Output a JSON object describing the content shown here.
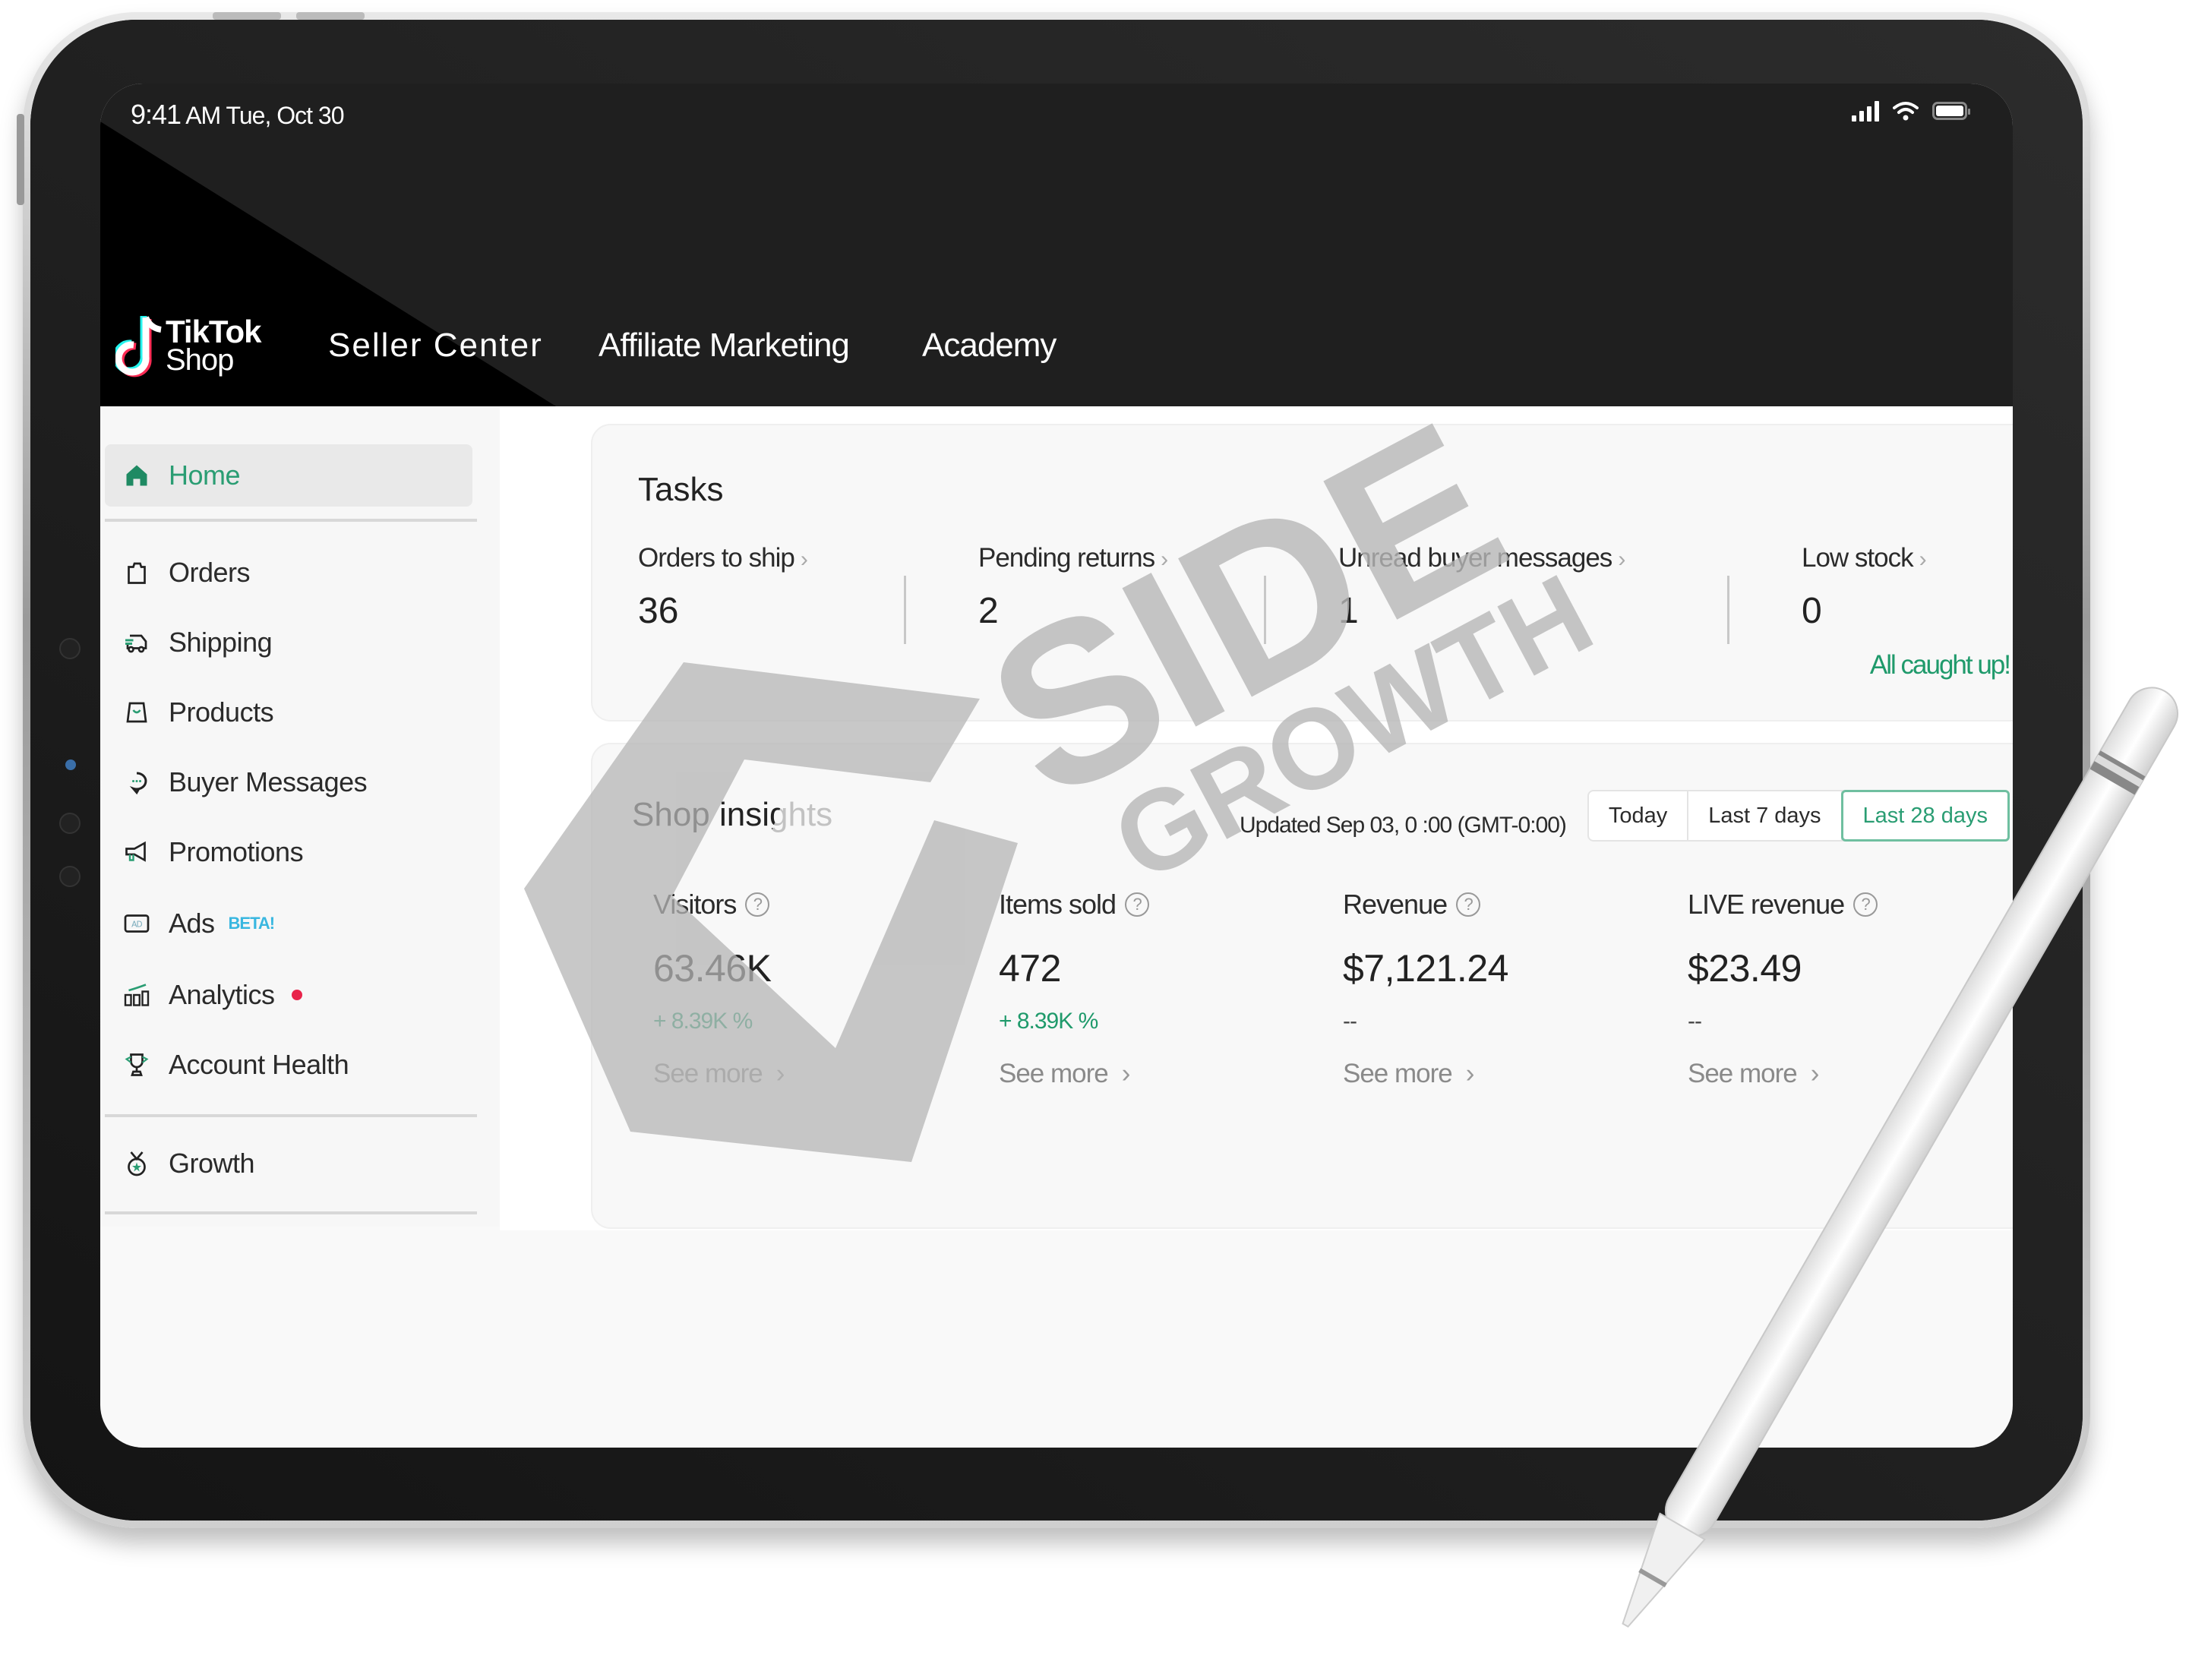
{
  "status_bar": {
    "time": "9:41",
    "date": "AM Tue, Oct 30",
    "icons": [
      "cellular-signal-icon",
      "wifi-icon",
      "battery-icon"
    ]
  },
  "header": {
    "logo": {
      "line1": "TikTok",
      "line2": "Shop",
      "icon": "tiktok-note-icon"
    },
    "nav": [
      {
        "label": "Seller Center"
      },
      {
        "label": "Affiliate Marketing"
      },
      {
        "label": "Academy"
      }
    ]
  },
  "sidebar": {
    "items": [
      {
        "label": "Home",
        "icon": "home-icon",
        "active": true
      },
      {
        "label": "Orders",
        "icon": "bag-icon"
      },
      {
        "label": "Shipping",
        "icon": "truck-icon"
      },
      {
        "label": "Products",
        "icon": "shopping-bag-icon"
      },
      {
        "label": "Buyer Messages",
        "icon": "chat-bubble-icon"
      },
      {
        "label": "Promotions",
        "icon": "megaphone-icon"
      },
      {
        "label": "Ads",
        "icon": "ad-icon",
        "badge": "BETA!"
      },
      {
        "label": "Analytics",
        "icon": "bar-chart-icon",
        "notification_dot": true
      },
      {
        "label": "Account Health",
        "icon": "trophy-icon"
      },
      {
        "label": "Growth",
        "icon": "medal-icon"
      }
    ]
  },
  "tasks": {
    "title": "Tasks",
    "items": [
      {
        "label": "Orders to ship",
        "value": "36"
      },
      {
        "label": "Pending returns",
        "value": "2"
      },
      {
        "label": "Unread buyer messages",
        "value": "1"
      },
      {
        "label": "Low stock",
        "value": "0",
        "note": "All caught up!"
      }
    ]
  },
  "shop_insights": {
    "title": "Shop insights",
    "updated": "Updated Sep 03, 0 :00  (GMT-0:00)",
    "ranges": [
      {
        "label": "Today",
        "selected": false
      },
      {
        "label": "Last 7 days",
        "selected": false
      },
      {
        "label": "Last 28 days",
        "selected": true
      }
    ],
    "metrics": [
      {
        "label": "Visitors",
        "value": "63.46K",
        "delta": "+ 8.39K %",
        "link": "See more"
      },
      {
        "label": "Items sold",
        "value": "472",
        "delta": "+ 8.39K %",
        "link": "See more"
      },
      {
        "label": "Revenue",
        "value": "$7,121.24",
        "delta": "--",
        "link": "See more"
      },
      {
        "label": "LIVE revenue",
        "value": "$23.49",
        "delta": "--",
        "link": "See more"
      }
    ],
    "help_glyph": "?"
  },
  "watermark": {
    "line1": "SIDE",
    "line2": "GROWTH"
  },
  "colors": {
    "accent_green": "#2a9d73",
    "beta_blue": "#39b7e0",
    "notification_red": "#e8234a",
    "header_bg": "#1f1f1f"
  }
}
